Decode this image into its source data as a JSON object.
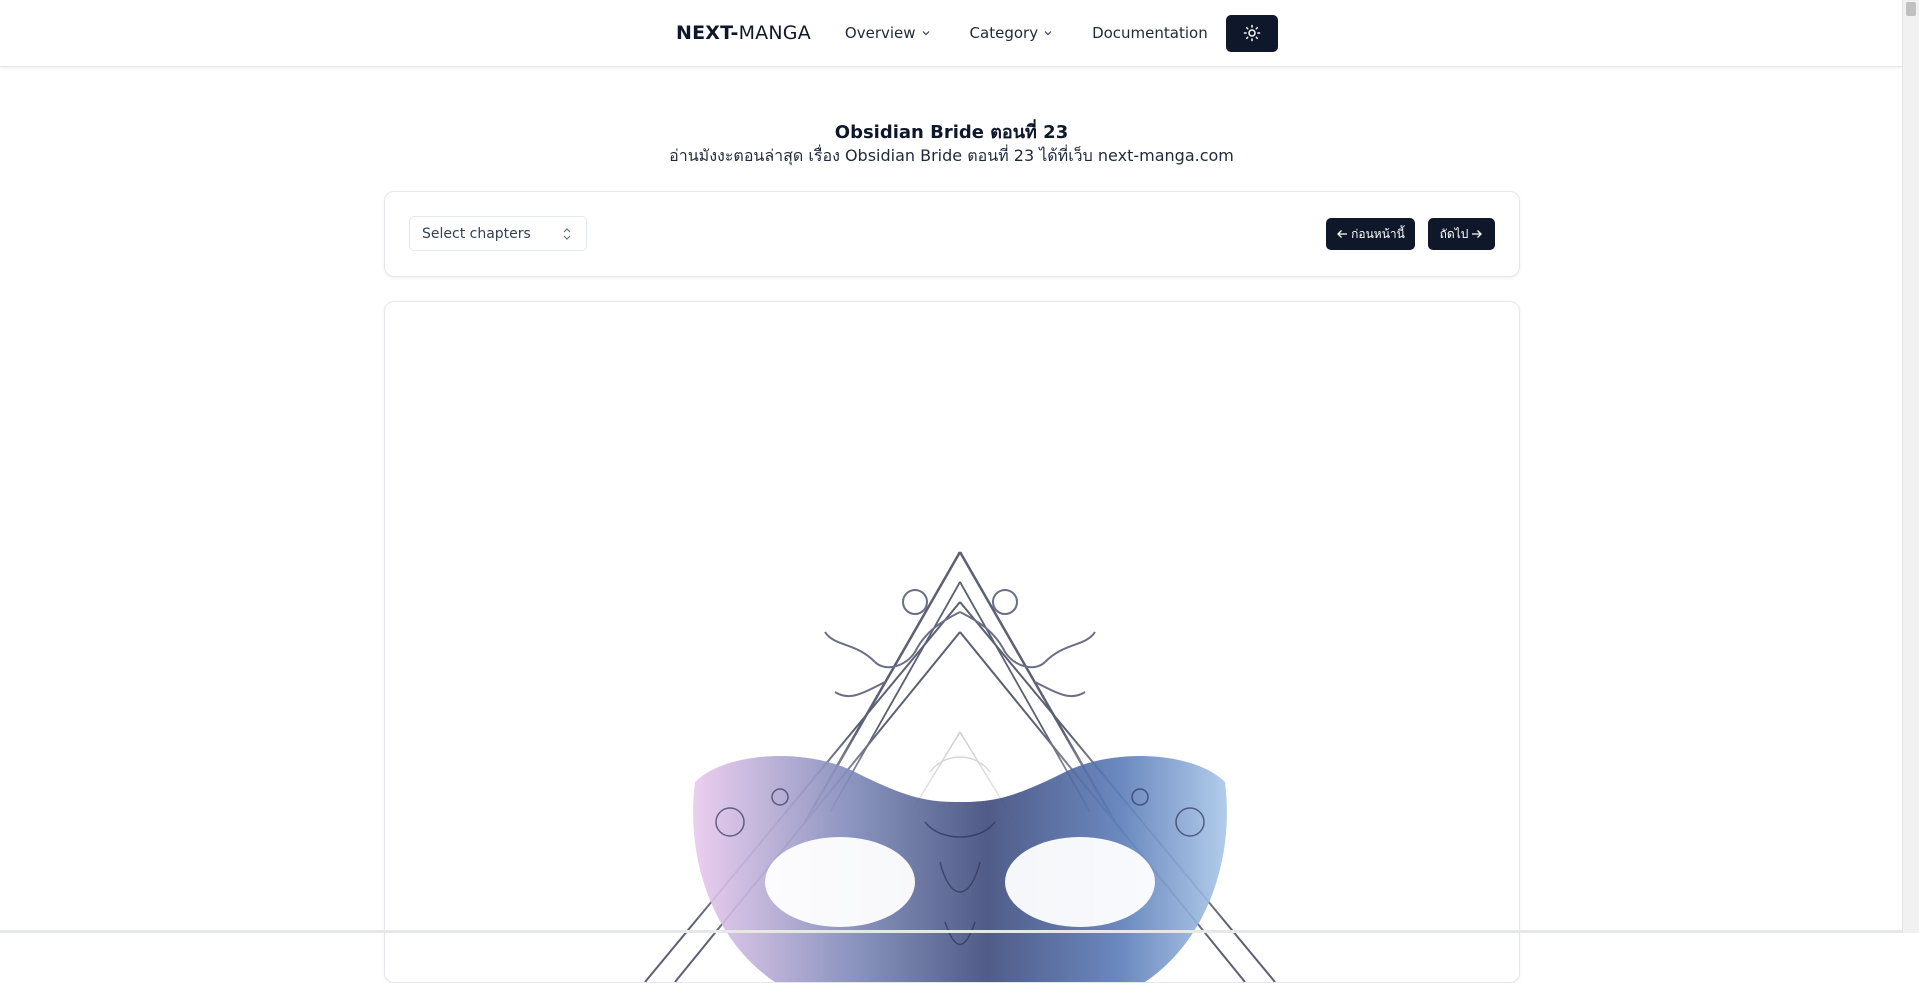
{
  "navbar": {
    "brand_bold": "NEXT-",
    "brand_rest": "MANGA",
    "links": [
      {
        "label": "Overview"
      },
      {
        "label": "Category"
      },
      {
        "label": "Documentation"
      }
    ],
    "theme_icon": "sun-icon"
  },
  "header": {
    "title": "Obsidian Bride ตอนที่ 23",
    "subtitle": "อ่านมังงะตอนล่าสุด เรื่อง Obsidian Bride ตอนที่ 23 ได้ที่เว็บ next-manga.com"
  },
  "toolbar": {
    "select_placeholder": "Select chapters",
    "prev_label": "ก่อนหน้านี้",
    "next_label": "ถัดไป"
  },
  "colors": {
    "primary": "#0f172a",
    "border": "#e5e7eb"
  }
}
